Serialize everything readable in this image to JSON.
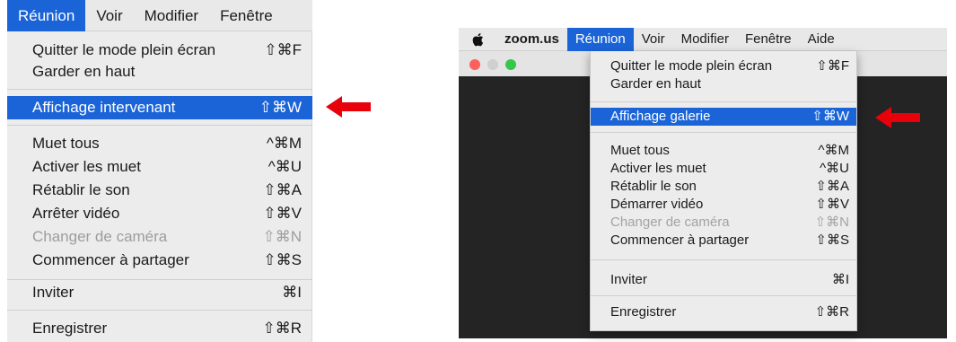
{
  "left": {
    "menubar": [
      "Réunion",
      "Voir",
      "Modifier",
      "Fenêtre"
    ],
    "items": [
      {
        "label": "Quitter le mode plein écran",
        "shortcut": "⇧⌘F"
      },
      {
        "label": "Garder en haut",
        "shortcut": ""
      },
      {
        "label": "Affichage intervenant",
        "shortcut": "⇧⌘W"
      },
      {
        "label": "Muet tous",
        "shortcut": "^⌘M"
      },
      {
        "label": "Activer les muet",
        "shortcut": "^⌘U"
      },
      {
        "label": "Rétablir le son",
        "shortcut": "⇧⌘A"
      },
      {
        "label": "Arrêter vidéo",
        "shortcut": "⇧⌘V"
      },
      {
        "label": "Changer de caméra",
        "shortcut": "⇧⌘N"
      },
      {
        "label": "Commencer à partager",
        "shortcut": "⇧⌘S"
      },
      {
        "label": "Inviter",
        "shortcut": "⌘I"
      },
      {
        "label": "Enregistrer",
        "shortcut": "⇧⌘R"
      }
    ]
  },
  "right": {
    "menubar": [
      "zoom.us",
      "Réunion",
      "Voir",
      "Modifier",
      "Fenêtre",
      "Aide"
    ],
    "items": [
      {
        "label": "Quitter le mode plein écran",
        "shortcut": "⇧⌘F"
      },
      {
        "label": "Garder en haut",
        "shortcut": ""
      },
      {
        "label": "Affichage galerie",
        "shortcut": "⇧⌘W"
      },
      {
        "label": "Muet tous",
        "shortcut": "^⌘M"
      },
      {
        "label": "Activer les muet",
        "shortcut": "^⌘U"
      },
      {
        "label": "Rétablir le son",
        "shortcut": "⇧⌘A"
      },
      {
        "label": "Démarrer vidéo",
        "shortcut": "⇧⌘V"
      },
      {
        "label": "Changer de caméra",
        "shortcut": "⇧⌘N"
      },
      {
        "label": "Commencer à partager",
        "shortcut": "⇧⌘S"
      },
      {
        "label": "Inviter",
        "shortcut": "⌘I"
      },
      {
        "label": "Enregistrer",
        "shortcut": "⇧⌘R"
      }
    ]
  },
  "colors": {
    "highlight": "#1b64d8",
    "arrow": "#e8000b",
    "window_dark": "#242424"
  },
  "icons": [
    "apple-logo-icon",
    "close-light-icon",
    "minimize-light-icon",
    "zoom-light-icon",
    "red-arrow-icon"
  ]
}
